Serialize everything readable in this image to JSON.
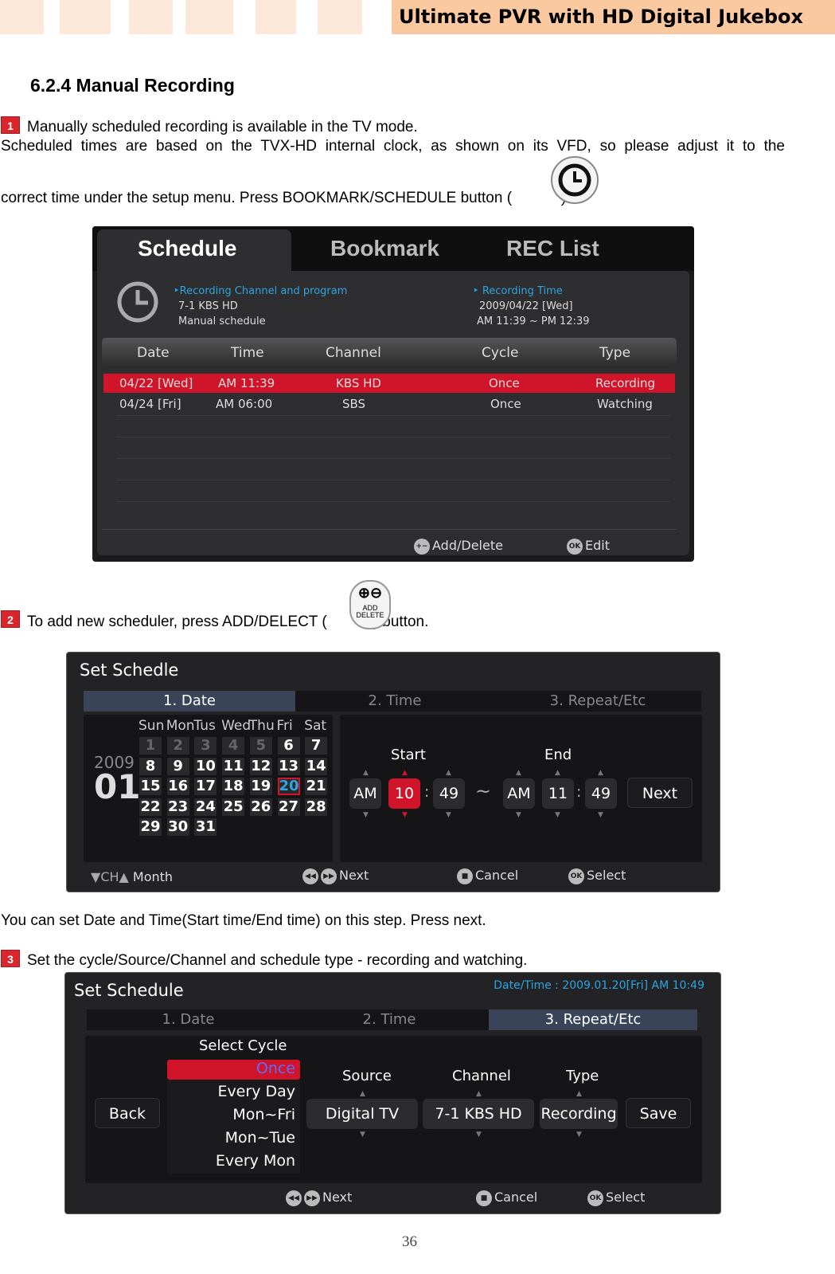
{
  "header": {
    "title": "Ultimate PVR with HD Digital Jukebox"
  },
  "section_title": "6.2.4 Manual Recording",
  "step1": {
    "num": "1",
    "line1": "Manually scheduled recording is available in the TV mode.",
    "line2": "Scheduled times are based on the TVX-HD internal clock, as shown on its VFD, so please adjust it to the",
    "line3_a": "correct time under the setup menu. Press BOOKMARK/SCHEDULE button (",
    "line3_b": ")."
  },
  "schedule_screen": {
    "tabs": [
      "Schedule",
      "Bookmark",
      "REC List"
    ],
    "active_tab": "Schedule",
    "info": {
      "channel_label": "Recording Channel and program",
      "channel": "7-1 KBS HD",
      "program": "Manual schedule",
      "time_label": "Recording Time",
      "date": "2009/04/22 [Wed]",
      "time": "AM 11:39 ~ PM 12:39"
    },
    "columns": [
      "Date",
      "Time",
      "Channel",
      "Cycle",
      "Type"
    ],
    "rows": [
      {
        "date": "04/22 [Wed]",
        "time": "AM 11:39",
        "channel": "KBS HD",
        "cycle": "Once",
        "type": "Recording",
        "selected": true
      },
      {
        "date": "04/24 [Fri]",
        "time": "AM 06:00",
        "channel": "SBS",
        "cycle": "Once",
        "type": "Watching",
        "selected": false
      }
    ],
    "hints": {
      "add_delete": "Add/Delete",
      "edit": "Edit"
    },
    "highlight_color": "#d0142a"
  },
  "step2": {
    "num": "2",
    "text_a": "To add new scheduler, press ADD/DELECT (",
    "text_b": ") button.",
    "icon_label": "ADD DELETE"
  },
  "set_screen1": {
    "title": "Set Schedle",
    "steps": [
      "1. Date",
      "2. Time",
      "3. Repeat/Etc"
    ],
    "active_step": 0,
    "year": "2009",
    "month": "01",
    "weekdays": [
      "Sun",
      "Mon",
      "Tus",
      "Wed",
      "Thu",
      "Fri",
      "Sat"
    ],
    "days_dim": [
      "1",
      "2",
      "3",
      "4",
      "5"
    ],
    "days": [
      "6",
      "7",
      "8",
      "9",
      "10",
      "11",
      "12",
      "13",
      "14",
      "15",
      "16",
      "17",
      "18",
      "19",
      "20",
      "21",
      "22",
      "23",
      "24",
      "25",
      "26",
      "27",
      "28",
      "29",
      "30",
      "31"
    ],
    "selected_day": "20",
    "start_label": "Start",
    "end_label": "End",
    "start": {
      "ampm": "AM",
      "hour": "10",
      "min": "49"
    },
    "end": {
      "ampm": "AM",
      "hour": "11",
      "min": "49"
    },
    "sep": "~",
    "colon": ":",
    "next": "Next",
    "hints": {
      "ch": "CH",
      "month": "Month",
      "next": "Next",
      "cancel": "Cancel",
      "select": "Select"
    }
  },
  "caption2": "You can set Date and Time(Start time/End time) on this step. Press next.",
  "step3": {
    "num": "3",
    "text": "Set the cycle/Source/Channel and schedule type - recording and watching."
  },
  "set_screen2": {
    "title": "Set Schedule",
    "datetime": "Date/Time : 2009.01.20[Fri] AM 10:49",
    "steps": [
      "1. Date",
      "2. Time",
      "3. Repeat/Etc"
    ],
    "active_step": 2,
    "back": "Back",
    "save": "Save",
    "select_cycle": "Select Cycle",
    "cycles": [
      "Once",
      "Every Day",
      "Mon~Fri",
      "Mon~Tue",
      "Every Mon"
    ],
    "selected_cycle": "Once",
    "source_label": "Source",
    "source": "Digital TV",
    "channel_label": "Channel",
    "channel": "7-1 KBS HD",
    "type_label": "Type",
    "type": "Recording",
    "hints": {
      "next": "Next",
      "cancel": "Cancel",
      "select": "Select"
    }
  },
  "page_number": "36"
}
